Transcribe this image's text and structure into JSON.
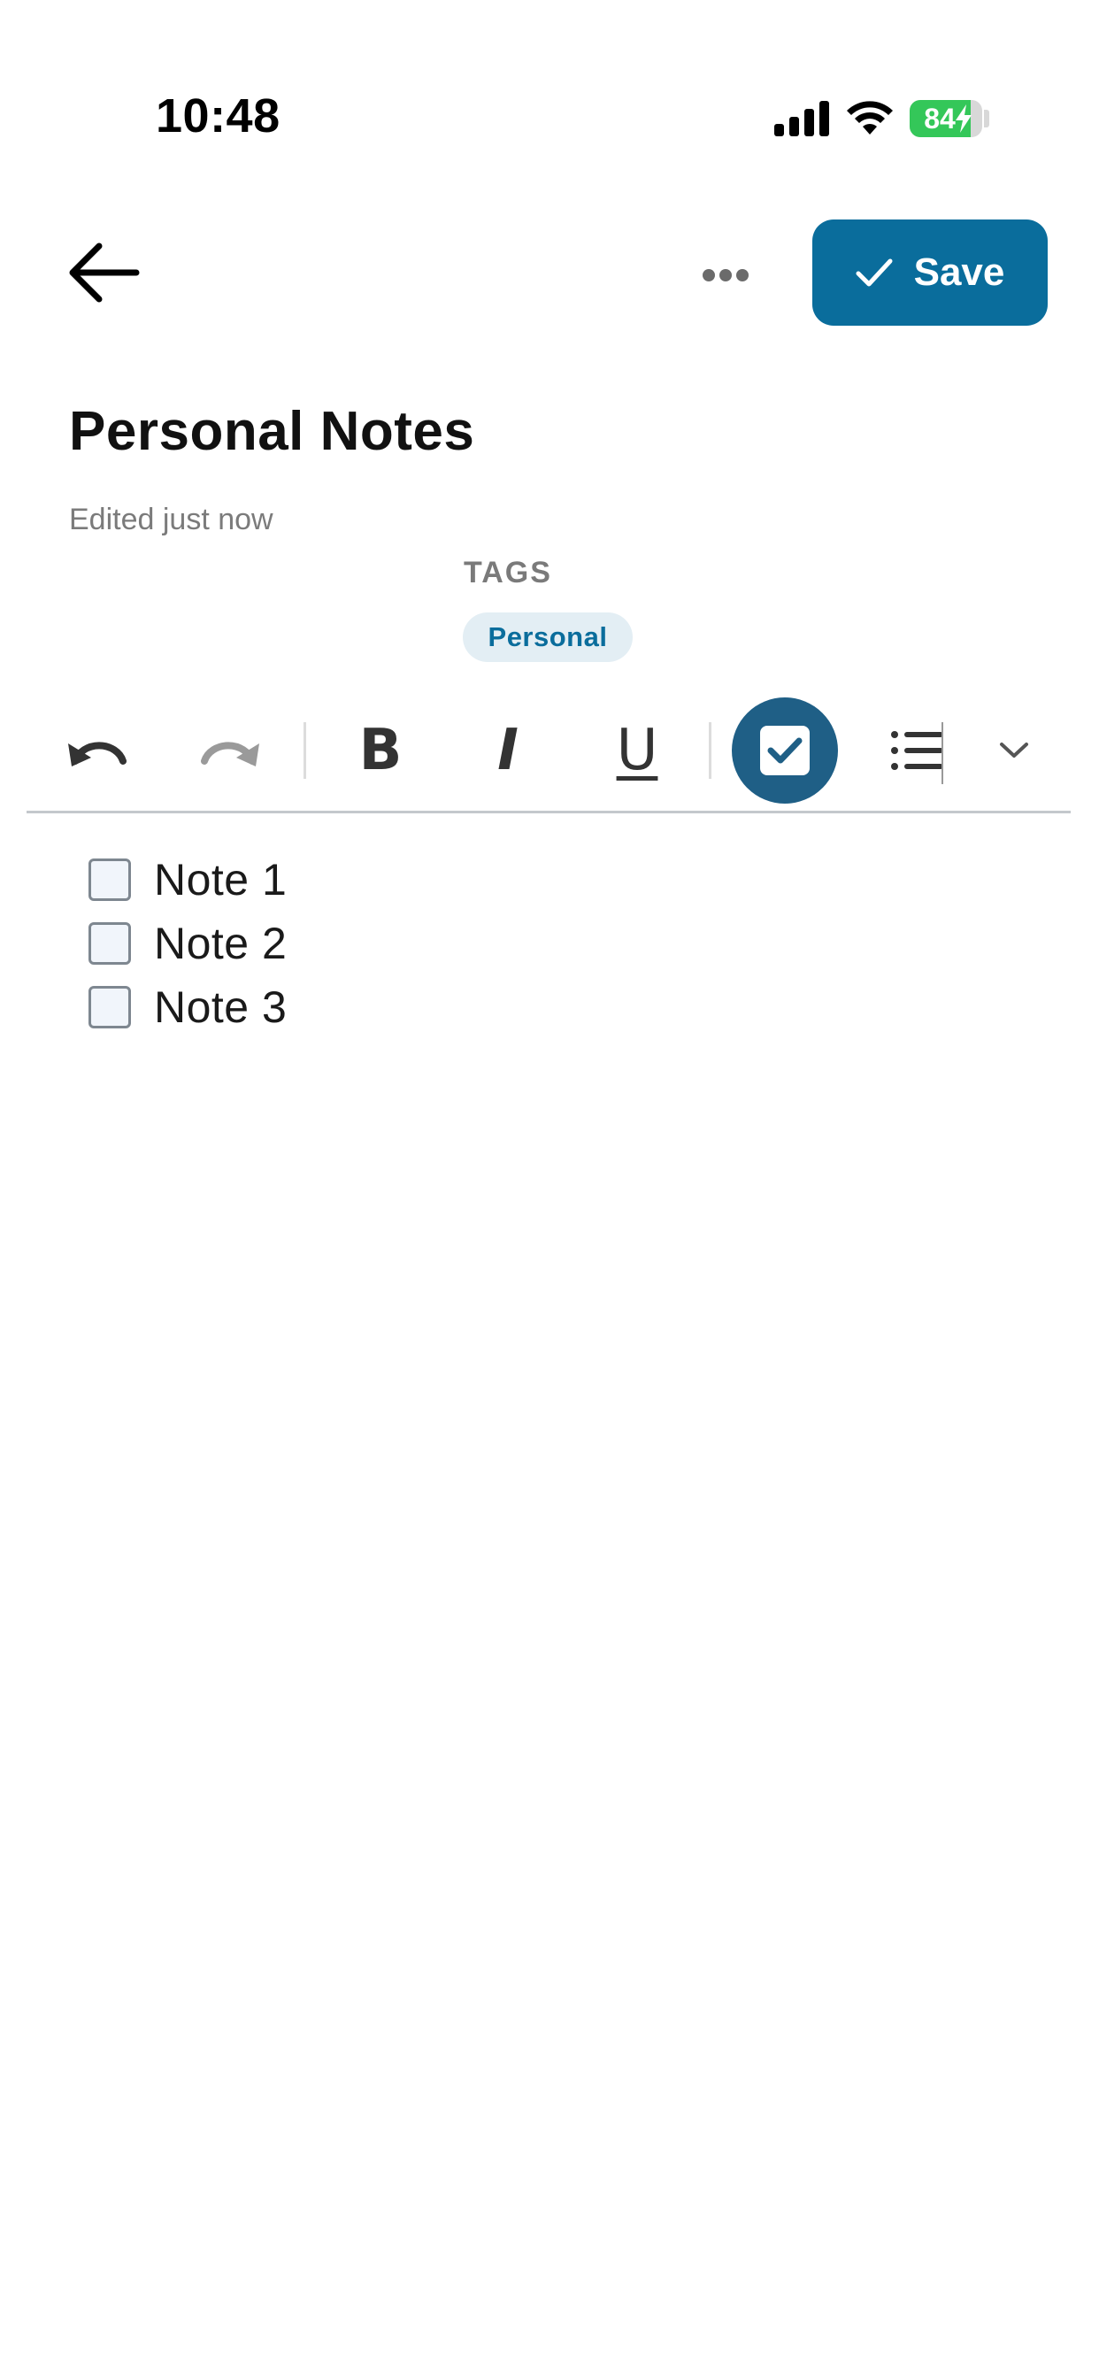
{
  "status_bar": {
    "time": "10:48",
    "battery_level": "84",
    "battery_fraction": 0.84
  },
  "topbar": {
    "back_icon": "arrow-left-icon",
    "more_icon": "more-horizontal-icon",
    "save_label": "Save",
    "save_color": "#0a6d9c"
  },
  "note": {
    "title": "Personal Notes",
    "edited_status": "Edited just now"
  },
  "tags": {
    "heading": "TAGS",
    "items": [
      "Personal"
    ]
  },
  "toolbar": {
    "undo_icon": "undo-icon",
    "redo_icon": "redo-icon",
    "bold_label": "B",
    "italic_label": "I",
    "underline_label": "U",
    "checklist_icon": "checklist-icon",
    "bullet_list_icon": "bullet-list-icon",
    "expand_icon": "chevron-down-icon",
    "active_color": "#1f5f86"
  },
  "checklist": {
    "items": [
      {
        "label": "Note 1",
        "checked": false
      },
      {
        "label": "Note 2",
        "checked": false
      },
      {
        "label": "Note 3",
        "checked": false
      }
    ]
  }
}
